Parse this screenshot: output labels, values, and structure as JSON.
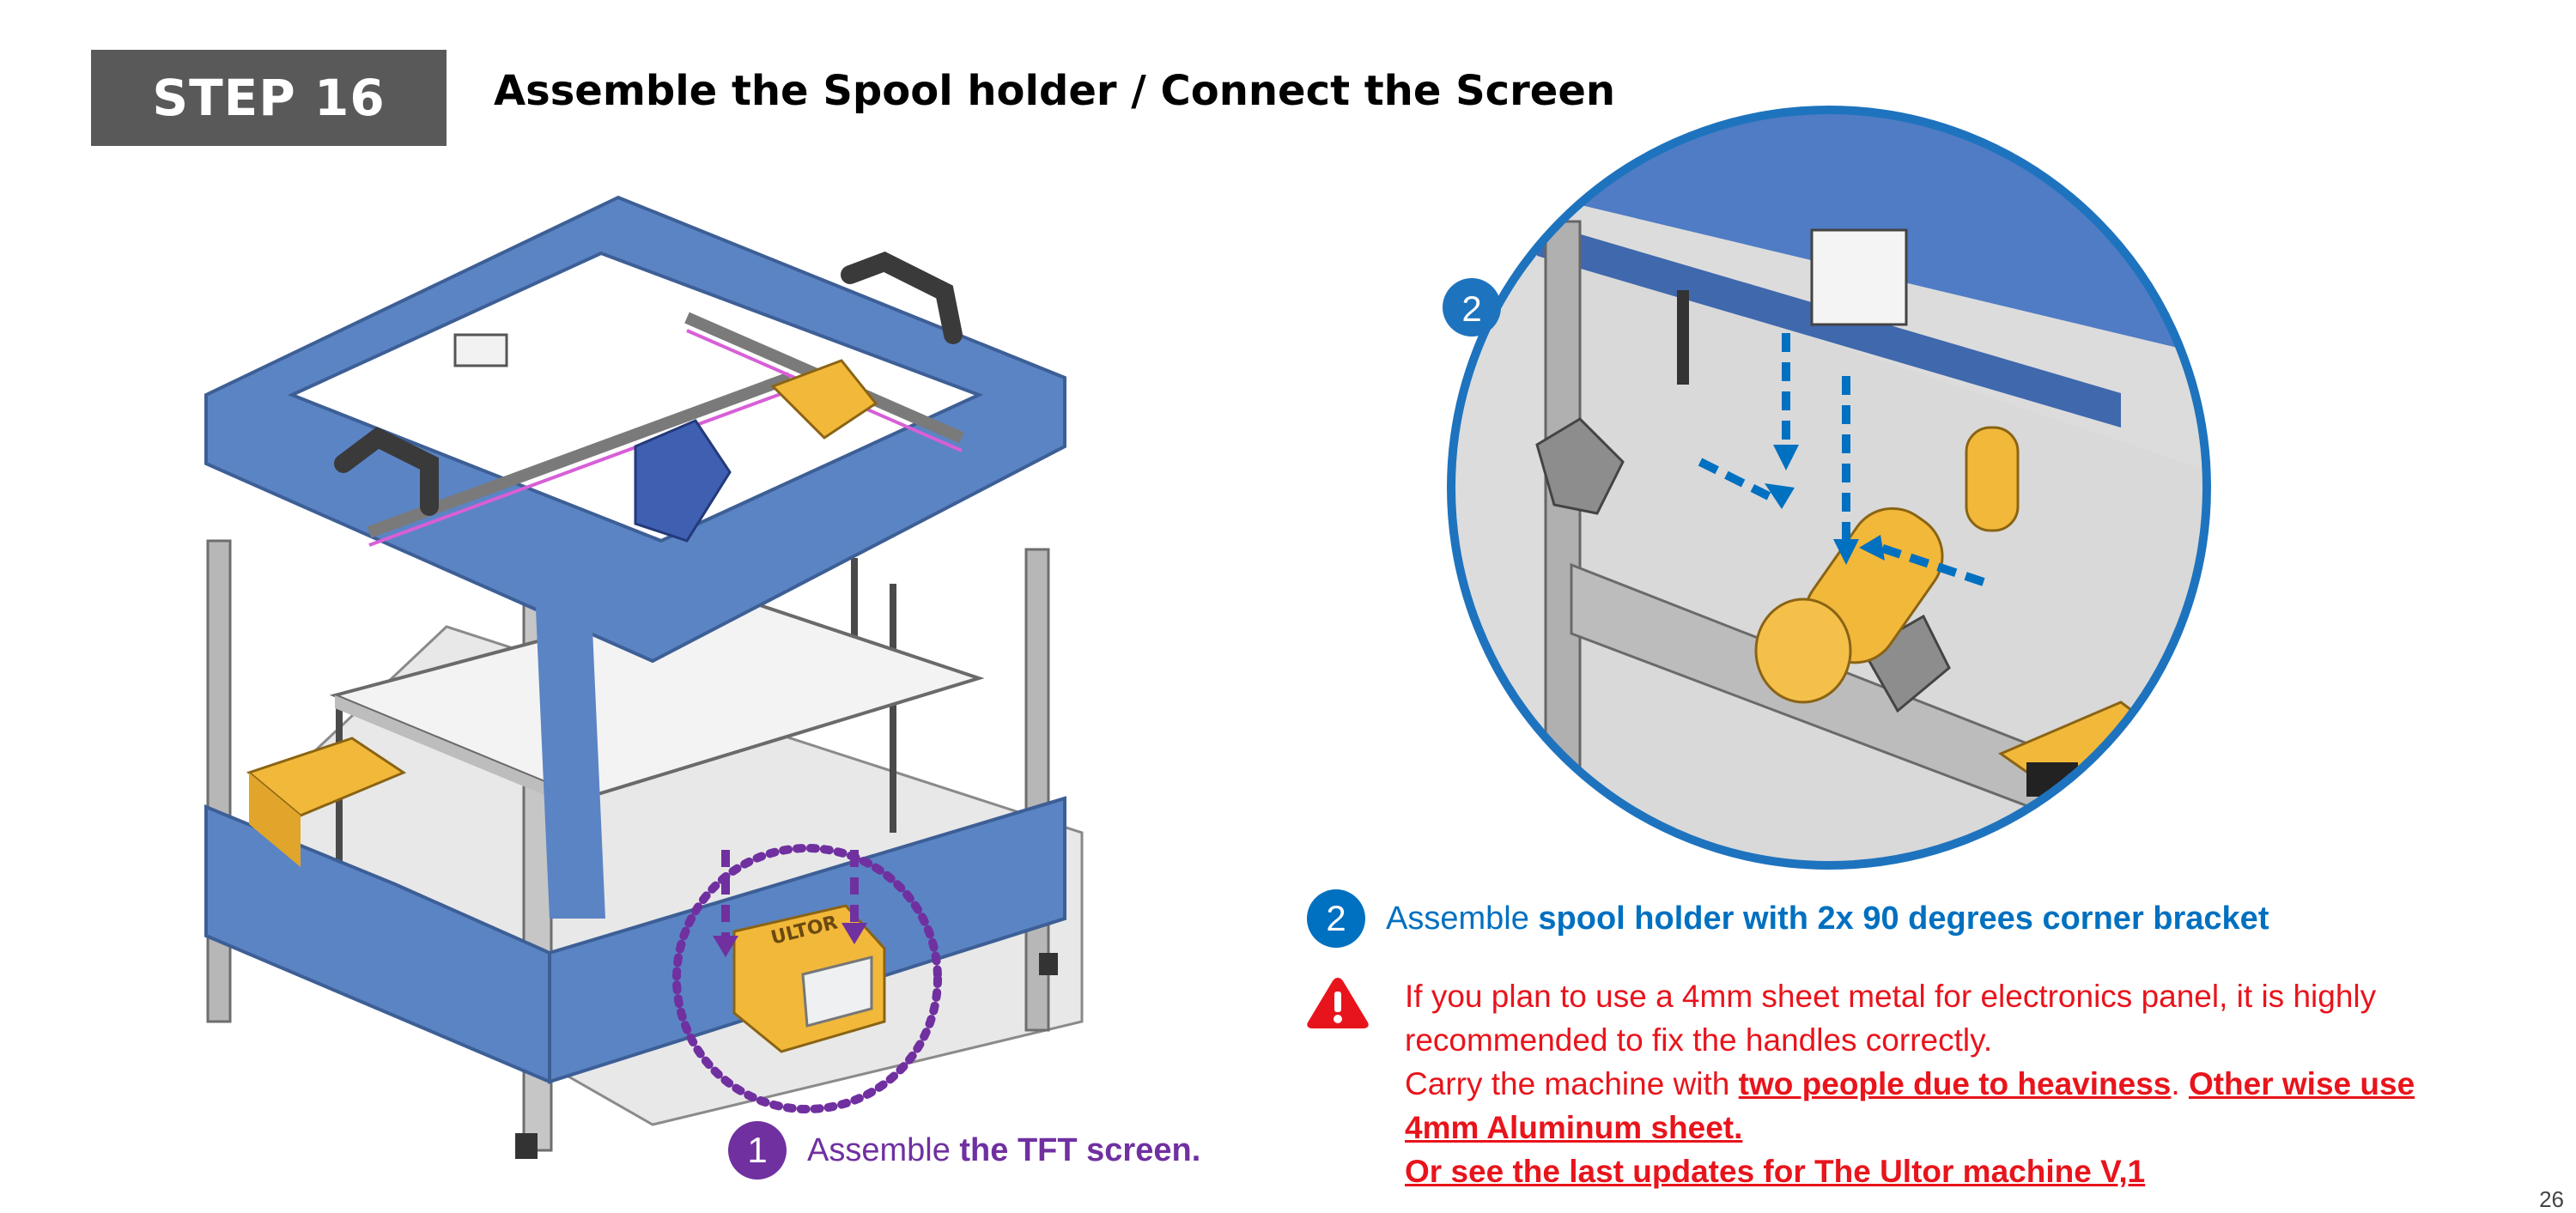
{
  "header": {
    "step_label": "STEP 16",
    "title": "Assemble the Spool holder / Connect the Screen"
  },
  "callouts": [
    {
      "number": "1",
      "text_plain": "Assemble ",
      "text_bold": "the TFT screen.",
      "color": "#7030a0"
    },
    {
      "number": "2",
      "text_plain": "Assemble ",
      "text_bold": "spool holder with 2x 90 degrees corner bracket",
      "color": "#0070c0"
    }
  ],
  "warning": {
    "icon": "warning-triangle-icon",
    "line1": "If you plan to use a 4mm sheet metal for electronics panel, it is highly",
    "line2": "recommended to fix the handles correctly.",
    "line3_prefix": "Carry the machine with ",
    "line3_emph1": "two people due to heaviness",
    "line3_sep": ". ",
    "line3_emph2": "Other wise use",
    "line4": "4mm Aluminum sheet.",
    "line5": "Or see the last updates for The Ultor machine V,1",
    "color": "#e8141c"
  },
  "illustrations": {
    "screen_logo": "ULTOR"
  },
  "colors": {
    "frame_blue": "#5b84c4",
    "part_yellow": "#f2b83a",
    "highlight_purple": "#7030a0",
    "highlight_blue": "#0070c0"
  },
  "footer": {
    "page_number": "26"
  }
}
